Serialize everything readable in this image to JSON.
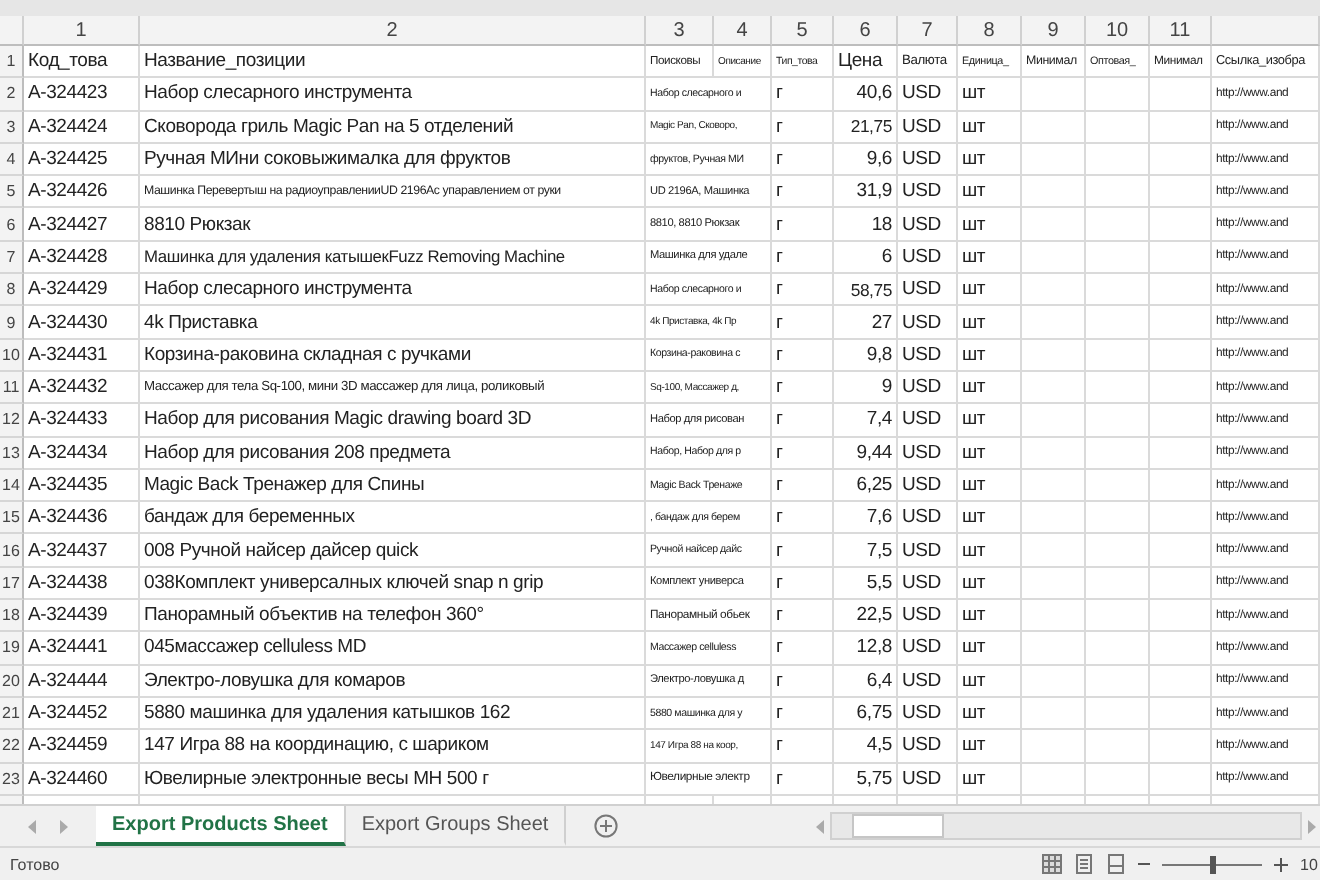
{
  "columns": [
    "1",
    "2",
    "3",
    "4",
    "5",
    "6",
    "7",
    "8",
    "9",
    "10",
    "11"
  ],
  "header_row": {
    "row": "1",
    "cells": [
      "Код_това",
      "Название_позиции",
      "Поисковы",
      "Описание",
      "Тип_това",
      "Цена",
      "Валюта",
      "Единица_",
      "Минимал",
      "Оптовая_",
      "Минимал",
      "Ссылка_изобра"
    ]
  },
  "rows": [
    {
      "row": "2",
      "code": "A-324423",
      "name": "Набор слесарного инструмента",
      "search": "Набор слесарного и",
      "type": "г",
      "price": "40,6",
      "currency": "USD",
      "unit": "шт",
      "image_link": "http://www.and"
    },
    {
      "row": "3",
      "code": "A-324424",
      "name": "Сковорода гриль Magic Pan на 5 отделений",
      "search": "Magic Pan, Сковоро,",
      "type": "г",
      "price": "21,75",
      "currency": "USD",
      "unit": "шт",
      "image_link": "http://www.and"
    },
    {
      "row": "4",
      "code": "A-324425",
      "name": "Ручная МИни соковыжималка для фруктов",
      "search": "фруктов, Ручная МИ",
      "type": "г",
      "price": "9,6",
      "currency": "USD",
      "unit": "шт",
      "image_link": "http://www.and"
    },
    {
      "row": "5",
      "code": "A-324426",
      "name": "Машинка Перевертыш на радиоуправленииUD 2196Ac упаравлением от руки",
      "search": "UD 2196A, Машинка",
      "type": "г",
      "price": "31,9",
      "currency": "USD",
      "unit": "шт",
      "image_link": "http://www.and"
    },
    {
      "row": "6",
      "code": "A-324427",
      "name": "8810 Рюкзак",
      "search": "8810, 8810 Рюкзак",
      "type": "г",
      "price": "18",
      "currency": "USD",
      "unit": "шт",
      "image_link": "http://www.and"
    },
    {
      "row": "7",
      "code": "A-324428",
      "name": "Машинка для удаления катышекFuzz Removing Machine",
      "search": "Машинка для удале",
      "type": "г",
      "price": "6",
      "currency": "USD",
      "unit": "шт",
      "image_link": "http://www.and"
    },
    {
      "row": "8",
      "code": "A-324429",
      "name": "Набор слесарного инструмента",
      "search": "Набор слесарного и",
      "type": "г",
      "price": "58,75",
      "currency": "USD",
      "unit": "шт",
      "image_link": "http://www.and"
    },
    {
      "row": "9",
      "code": "A-324430",
      "name": "4k Приставка",
      "search": "4k Приставка, 4k Пр",
      "type": "г",
      "price": "27",
      "currency": "USD",
      "unit": "шт",
      "image_link": "http://www.and"
    },
    {
      "row": "10",
      "code": "A-324431",
      "name": "Корзина-раковина складная с ручками",
      "search": "Корзина-раковина с",
      "type": "г",
      "price": "9,8",
      "currency": "USD",
      "unit": "шт",
      "image_link": "http://www.and"
    },
    {
      "row": "11",
      "code": "A-324432",
      "name": "Массажер для тела Sq-100, мини 3D массажер для лица, роликовый",
      "search": "Sq-100, Массажер д,",
      "type": "г",
      "price": "9",
      "currency": "USD",
      "unit": "шт",
      "image_link": "http://www.and"
    },
    {
      "row": "12",
      "code": "A-324433",
      "name": "Набор для рисования Magic drawing board 3D",
      "search": "Набор для рисован",
      "type": "г",
      "price": "7,4",
      "currency": "USD",
      "unit": "шт",
      "image_link": "http://www.and"
    },
    {
      "row": "13",
      "code": "A-324434",
      "name": "Набор для рисования 208 предмета",
      "search": "Набор, Набор для р",
      "type": "г",
      "price": "9,44",
      "currency": "USD",
      "unit": "шт",
      "image_link": "http://www.and"
    },
    {
      "row": "14",
      "code": "A-324435",
      "name": "Magic Back Тренажер для Спины",
      "search": "Magic Back Тренаже",
      "type": "г",
      "price": "6,25",
      "currency": "USD",
      "unit": "шт",
      "image_link": "http://www.and"
    },
    {
      "row": "15",
      "code": "A-324436",
      "name": "бандаж для беременных",
      "search": ", бандаж для берем",
      "type": "г",
      "price": "7,6",
      "currency": "USD",
      "unit": "шт",
      "image_link": "http://www.and"
    },
    {
      "row": "16",
      "code": "A-324437",
      "name": "008 Ручной найсер дайсер quick",
      "search": "Ручной найсер дайс",
      "type": "г",
      "price": "7,5",
      "currency": "USD",
      "unit": "шт",
      "image_link": "http://www.and"
    },
    {
      "row": "17",
      "code": "A-324438",
      "name": "038Комплект универсалных ключей snap n grip",
      "search": "Комплект универса",
      "type": "г",
      "price": "5,5",
      "currency": "USD",
      "unit": "шт",
      "image_link": "http://www.and"
    },
    {
      "row": "18",
      "code": "A-324439",
      "name": "Панорамный объектив на телефон 360°",
      "search": "Панорамный обьек",
      "type": "г",
      "price": "22,5",
      "currency": "USD",
      "unit": "шт",
      "image_link": "http://www.and"
    },
    {
      "row": "19",
      "code": "A-324441",
      "name": "045массажер celluless MD",
      "search": "Массажер celluless",
      "type": "г",
      "price": "12,8",
      "currency": "USD",
      "unit": "шт",
      "image_link": "http://www.and"
    },
    {
      "row": "20",
      "code": "A-324444",
      "name": "Электро-ловушка для комаров",
      "search": "Электро-ловушка д",
      "type": "г",
      "price": "6,4",
      "currency": "USD",
      "unit": "шт",
      "image_link": "http://www.and"
    },
    {
      "row": "21",
      "code": "A-324452",
      "name": "5880 машинка для удаления катышков 162",
      "search": "5880 машинка для у",
      "type": "г",
      "price": "6,75",
      "currency": "USD",
      "unit": "шт",
      "image_link": "http://www.and"
    },
    {
      "row": "22",
      "code": "A-324459",
      "name": "147 Игра 88 на координацию, с шариком",
      "search": "147 Игра 88 на коор,",
      "type": "г",
      "price": "4,5",
      "currency": "USD",
      "unit": "шт",
      "image_link": "http://www.and"
    },
    {
      "row": "23",
      "code": "A-324460",
      "name": "Ювелирные электронные весы MH 500 г",
      "search": "Ювелирные электр",
      "type": "г",
      "price": "5,75",
      "currency": "USD",
      "unit": "шт",
      "image_link": "http://www.and"
    }
  ],
  "sheet_tabs": [
    {
      "label": "Export Products Sheet",
      "selected": true
    },
    {
      "label": "Export Groups Sheet",
      "selected": false
    }
  ],
  "status_bar": {
    "text": "Готово",
    "zoom": {
      "level": 0.5,
      "reading": "10"
    }
  }
}
